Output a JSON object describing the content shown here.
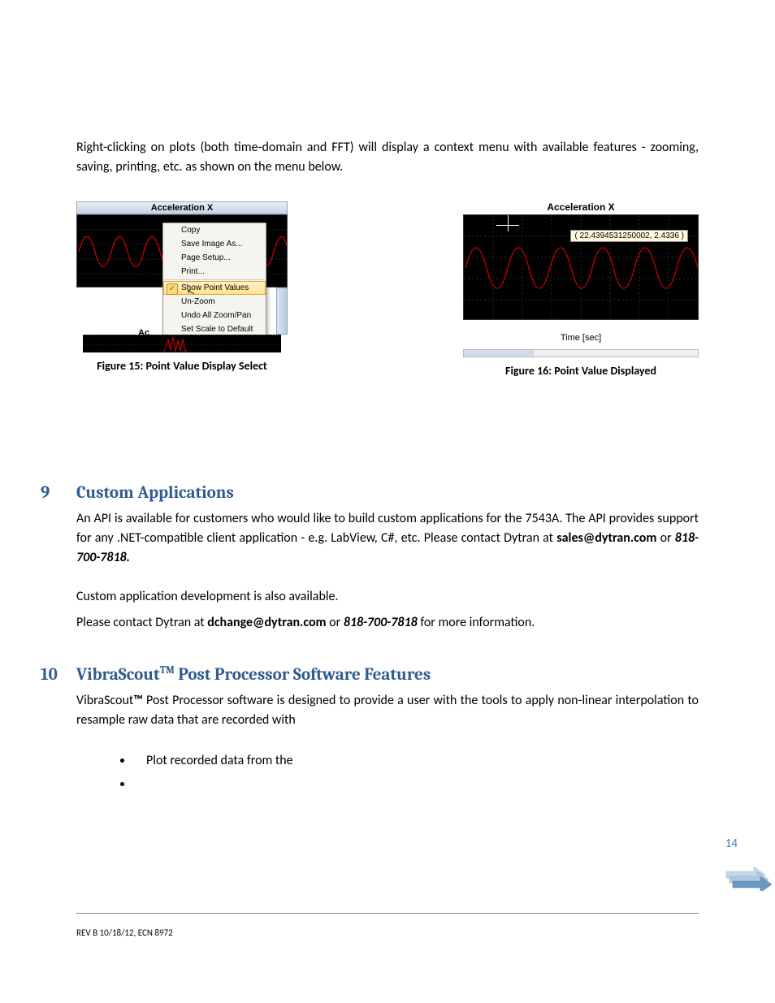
{
  "intro_text": "Right-clicking on plots (both time-domain and FFT) will display a context menu with available features - zooming, saving, printing, etc. as shown on the menu below.",
  "figure15": {
    "title": "Acceleration X",
    "menu_items": {
      "copy": "Copy",
      "save_image": "Save Image As...",
      "page_setup": "Page Setup...",
      "print": "Print...",
      "show_point_values": "Show Point Values",
      "unzoom": "Un-Zoom",
      "undo_zoom": "Undo All Zoom/Pan",
      "set_scale": "Set Scale to Default"
    },
    "partial_label": "Ac",
    "caption": "Figure 15: Point Value Display Select"
  },
  "figure16": {
    "title": "Acceleration X",
    "tooltip": "( 22.4394531250002, 2.4336 )",
    "xlabel": "Time [sec]",
    "caption": "Figure 16: Point Value Displayed"
  },
  "section9": {
    "number": "9",
    "title": "Custom Applications",
    "p1_a": "An API is available for customers who would like to build custom applications for the 7543A. The API provides support for any .NET-compatible client application - e.g. LabView, C#, etc. Please contact Dytran at ",
    "email1": "sales@dytran.com",
    "p1_b": " or ",
    "phone1": "818-700-7818.",
    "p2": "Custom application development is also available.",
    "p3_a": "Please contact Dytran at ",
    "email2": "dchange@dytran.com",
    "p3_b": " or ",
    "phone2": "818-700-7818",
    "p3_c": " for more information."
  },
  "section10": {
    "number": "10",
    "title_a": "VibraScout",
    "title_tm": "TM",
    "title_b": " Post Processor Software Features",
    "p1_a": "VibraScout",
    "p1_tm": "™",
    "p1_b": " Post Processor software is designed to provide a user with the tools to apply non-linear interpolation to resample raw data that are recorded with",
    "bullet1": "Plot  recorded data from the",
    "bullet2": ""
  },
  "page_number": "14",
  "footer": "REV B 10/18/12, ECN 8972"
}
